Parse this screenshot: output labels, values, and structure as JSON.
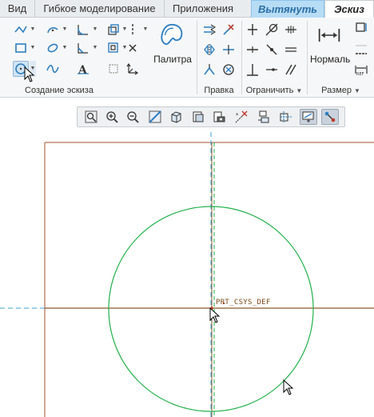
{
  "tabs": [
    {
      "label": "Вид"
    },
    {
      "label": "Гибкое моделирование"
    },
    {
      "label": "Приложения"
    },
    {
      "label": "Вытянуть"
    },
    {
      "label": "Эскиз"
    }
  ],
  "ribbon": {
    "groups": {
      "sketching": {
        "label": "Создание эскиза"
      },
      "editing": {
        "label": "Правка"
      },
      "constrain": {
        "label": "Ограничить"
      },
      "dimension": {
        "label": "Размер"
      }
    },
    "palette_label": "Палитра",
    "normal_label": "Нормаль"
  },
  "canvas": {
    "csys_label": "PRT_CSYS_DEF"
  },
  "colors": {
    "accent_tab": "#b7dcf5",
    "circle": "#22b14c",
    "centerline": "#3aa7d8",
    "axis": "#8b5a2b",
    "frame": "#a0522d"
  }
}
